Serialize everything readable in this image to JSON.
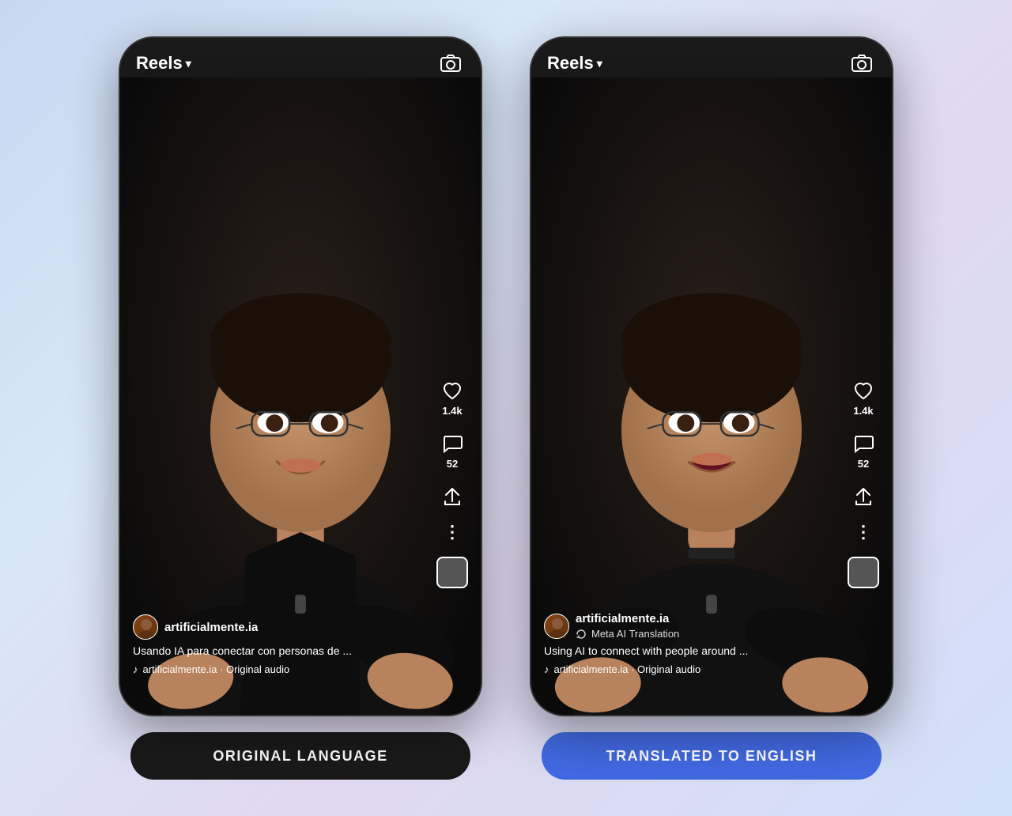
{
  "left_phone": {
    "header": {
      "title": "Reels",
      "chevron": "▾"
    },
    "camera_icon": "📷",
    "side_icons": {
      "like_count": "1.4k",
      "comment_count": "52"
    },
    "bottom_info": {
      "username": "artificialmente.ia",
      "caption": "Usando IA para conectar con personas de ...",
      "audio": "artificialmente.ia · Original audio"
    },
    "badge": {
      "label": "ORIGINAL LANGUAGE",
      "type": "dark"
    }
  },
  "right_phone": {
    "header": {
      "title": "Reels",
      "chevron": "▾"
    },
    "camera_icon": "📷",
    "side_icons": {
      "like_count": "1.4k",
      "comment_count": "52"
    },
    "bottom_info": {
      "username": "artificialmente.ia",
      "translation_label": "Meta AI Translation",
      "caption": "Using AI to connect with people around ...",
      "audio": "artificialmente.ia · Original audio"
    },
    "badge": {
      "label": "TRANSLATED TO ENGLISH",
      "type": "blue"
    }
  }
}
